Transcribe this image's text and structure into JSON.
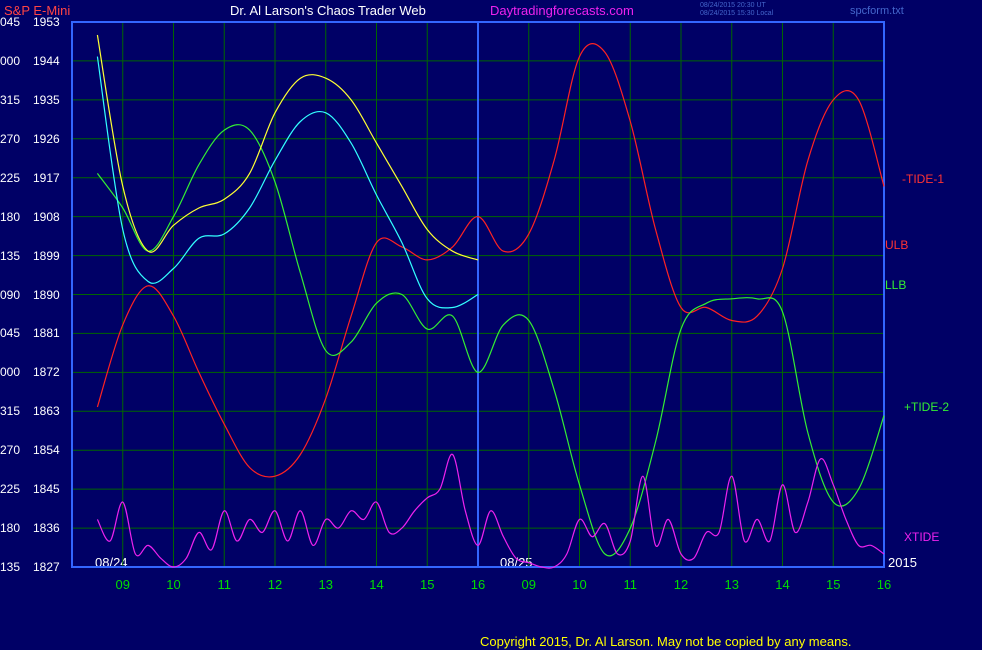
{
  "header": {
    "symbol": "S&P E-Mini",
    "title": "Dr. Al Larson's Chaos Trader Web",
    "site": "Daytradingforecasts.com",
    "timestamp_ut": "08/24/2015 20:30 UT",
    "timestamp_local": "08/24/2015 15:30 Local",
    "file": "spcform.txt"
  },
  "footer": {
    "copyright": "Copyright 2015, Dr. Al Larson. May not be copied by any means."
  },
  "colors": {
    "background": "#000066",
    "grid": "#006600",
    "frame": "#3366ff",
    "price_up": "#ffffff",
    "price_down": "#ff0000",
    "tide1": "#ff2222",
    "tide2": "#33ee33",
    "xtide": "#ee22ee",
    "avg1": "#ffff33",
    "avg2": "#33ffff"
  },
  "chart_data": {
    "type": "line",
    "title": "S&P E-Mini",
    "xlabel": "",
    "ylabel": "",
    "ylim": [
      1827,
      1953
    ],
    "y_ticks": [
      {
        "time": "135",
        "price": "1827"
      },
      {
        "time": "180",
        "price": "1836"
      },
      {
        "time": "225",
        "price": "1845"
      },
      {
        "time": "270",
        "price": "1854"
      },
      {
        "time": "315",
        "price": "1863"
      },
      {
        "time": "000",
        "price": "1872"
      },
      {
        "time": "045",
        "price": "1881"
      },
      {
        "time": "090",
        "price": "1890"
      },
      {
        "time": "135",
        "price": "1899"
      },
      {
        "time": "180",
        "price": "1908"
      },
      {
        "time": "225",
        "price": "1917"
      },
      {
        "time": "270",
        "price": "1926"
      },
      {
        "time": "315",
        "price": "1935"
      },
      {
        "time": "000",
        "price": "1944"
      },
      {
        "time": "045",
        "price": "1953"
      }
    ],
    "x_ticks": [
      "09",
      "10",
      "11",
      "12",
      "13",
      "14",
      "15",
      "16",
      "09",
      "10",
      "11",
      "12",
      "13",
      "14",
      "15",
      "16"
    ],
    "day_labels": [
      "08/24",
      "08/25"
    ],
    "year_label": "2015",
    "grid": true,
    "series": [
      {
        "name": "-TIDE-1",
        "x": [
          8.5,
          9,
          9.5,
          10,
          10.5,
          11,
          11.5,
          12,
          12.5,
          13,
          13.5,
          14,
          14.5,
          15,
          15.5,
          16,
          16.5,
          17,
          17.5,
          18,
          18.5,
          19,
          19.5,
          20,
          20.5,
          21,
          21.5,
          22,
          22.5,
          23,
          23.5,
          24
        ],
        "values": [
          1864,
          1883,
          1892,
          1885,
          1872,
          1860,
          1850,
          1848,
          1853,
          1866,
          1885,
          1902,
          1901,
          1898,
          1901,
          1908,
          1900,
          1904,
          1921,
          1945,
          1946,
          1930,
          1905,
          1887,
          1887,
          1884,
          1885,
          1896,
          1921,
          1935,
          1935,
          1915
        ]
      },
      {
        "name": "+TIDE-2",
        "x": [
          8.5,
          9,
          9.5,
          10,
          10.5,
          11,
          11.5,
          12,
          12.5,
          13,
          13.5,
          14,
          14.5,
          15,
          15.5,
          16,
          16.5,
          17,
          17.5,
          18,
          18.5,
          19,
          19.5,
          20,
          20.5,
          21,
          21.5,
          22,
          22.5,
          23,
          23.5,
          24
        ],
        "values": [
          1918,
          1910,
          1900,
          1908,
          1920,
          1928,
          1928,
          1916,
          1895,
          1877,
          1879,
          1888,
          1890,
          1882,
          1885,
          1872,
          1883,
          1884,
          1868,
          1846,
          1830,
          1836,
          1856,
          1882,
          1888,
          1889,
          1889,
          1886,
          1858,
          1842,
          1845,
          1862
        ]
      },
      {
        "name": "XTIDE",
        "x": [
          8.5,
          8.75,
          9,
          9.25,
          9.5,
          9.75,
          10,
          10.25,
          10.5,
          10.75,
          11,
          11.25,
          11.5,
          11.75,
          12,
          12.25,
          12.5,
          12.75,
          13,
          13.25,
          13.5,
          13.75,
          14,
          14.25,
          14.5,
          14.75,
          15,
          15.25,
          15.5,
          15.75,
          16,
          16.25,
          16.5,
          16.75,
          17,
          17.25,
          17.5,
          17.75,
          18,
          18.25,
          18.5,
          18.75,
          19,
          19.25,
          19.5,
          19.75,
          20,
          20.25,
          20.5,
          20.75,
          21,
          21.25,
          21.5,
          21.75,
          22,
          22.25,
          22.5,
          22.75,
          23,
          23.25,
          23.5,
          23.75,
          24
        ],
        "values": [
          1838,
          1833,
          1842,
          1830,
          1832,
          1829,
          1827,
          1829,
          1835,
          1831,
          1840,
          1833,
          1838,
          1835,
          1840,
          1833,
          1840,
          1832,
          1838,
          1836,
          1840,
          1838,
          1842,
          1835,
          1836,
          1840,
          1843,
          1845,
          1853,
          1840,
          1832,
          1840,
          1834,
          1829,
          1828,
          1827,
          1827,
          1830,
          1838,
          1834,
          1837,
          1830,
          1833,
          1848,
          1832,
          1838,
          1830,
          1829,
          1835,
          1835,
          1848,
          1833,
          1838,
          1833,
          1846,
          1835,
          1842,
          1852,
          1846,
          1838,
          1832,
          1832,
          1830
        ]
      },
      {
        "name": "ULB",
        "x": [
          8.5,
          9,
          9.5,
          10,
          10.5,
          11,
          11.5,
          12,
          12.5,
          13,
          13.5,
          14,
          14.5,
          15,
          15.5,
          16
        ],
        "values": [
          1950,
          1915,
          1900,
          1906,
          1910,
          1912,
          1918,
          1932,
          1940,
          1940,
          1935,
          1925,
          1915,
          1905,
          1900,
          1898
        ]
      },
      {
        "name": "LLB",
        "x": [
          8.5,
          9,
          9.5,
          10,
          10.5,
          11,
          11.5,
          12,
          12.5,
          13,
          13.5,
          14,
          14.5,
          15,
          15.5,
          16
        ],
        "values": [
          1945,
          1905,
          1893,
          1896,
          1903,
          1904,
          1910,
          1921,
          1930,
          1932,
          1925,
          1913,
          1902,
          1889,
          1887,
          1890
        ]
      }
    ]
  },
  "right_labels": {
    "tide1": "-TIDE-1",
    "ulb": "ULB",
    "llb": "LLB",
    "tide2": "+TIDE-2",
    "xtide": "XTIDE"
  }
}
